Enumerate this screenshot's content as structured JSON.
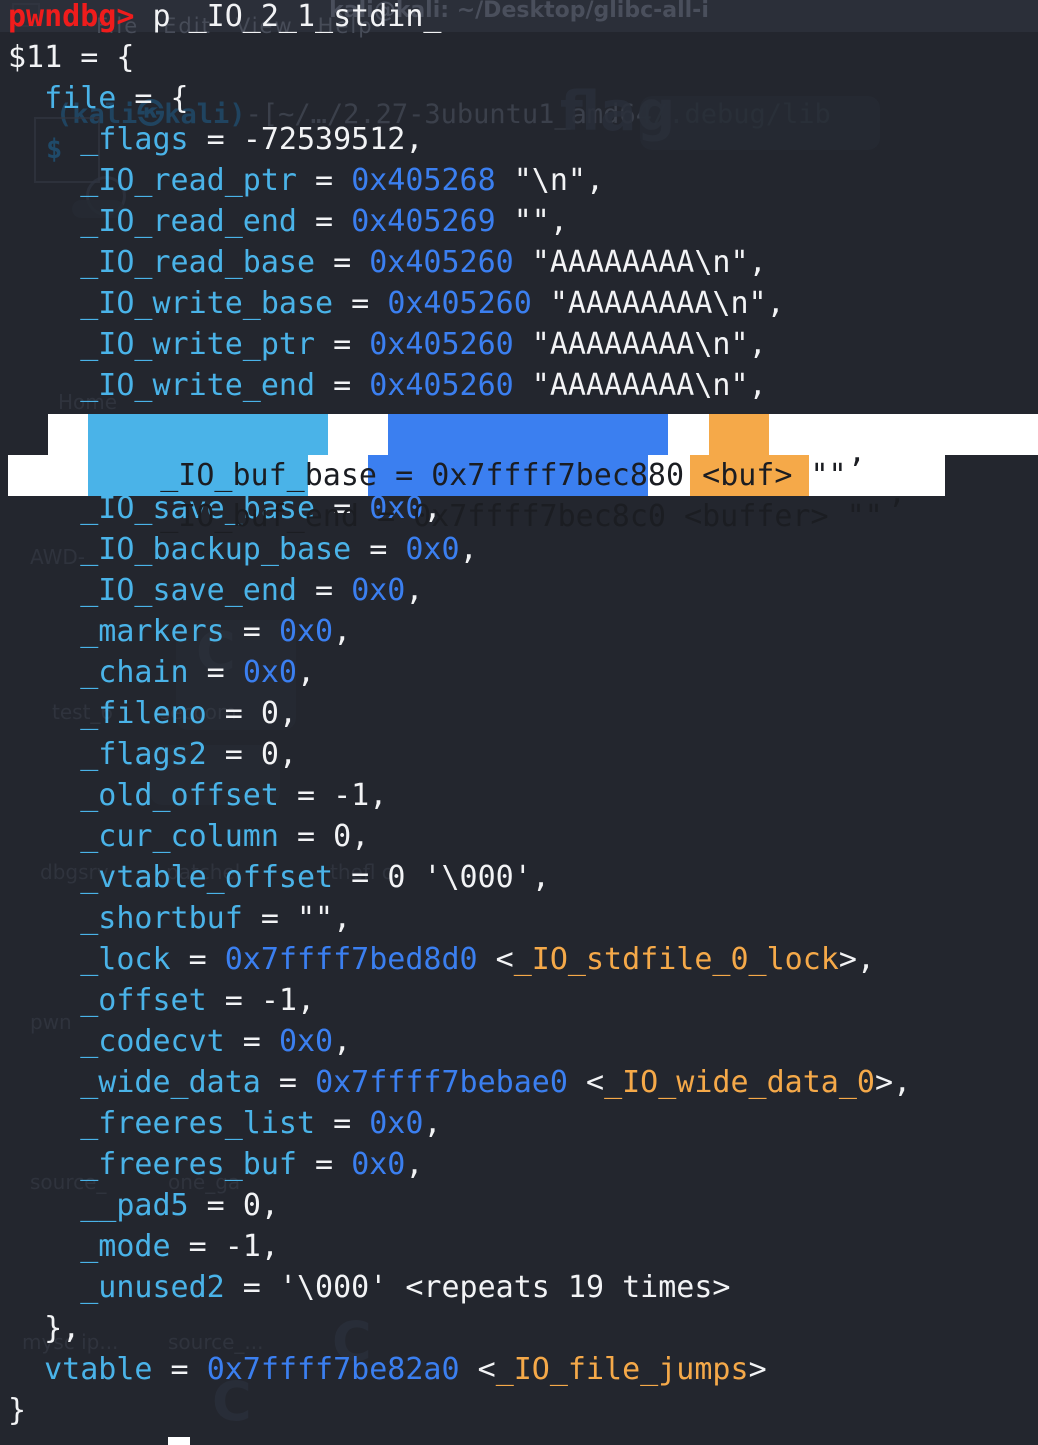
{
  "window": {
    "title": "kali@kali: ~/Desktop/glibc-all-i",
    "menu": [
      "File",
      "Edit",
      "View",
      "Help"
    ],
    "background_prompt": {
      "user_host": "(kali㉿kali)",
      "path": "-[~/…/2.27-3ubuntu1_amd64/.debug/lib",
      "dollar": "$"
    },
    "watermarks": [
      "Home",
      "AWD-",
      "test_6",
      "seccom",
      "dbgsrv",
      "patchel",
      "thefl o",
      "source_",
      "one_ga",
      "mysc ip...",
      "source_...",
      "pwn",
      "C",
      "flag"
    ]
  },
  "terminal": {
    "prompt": "pwndbg>",
    "command": "p _IO_2_1_stdin_",
    "result_var": "$11 = {",
    "struct_open": "  file = {",
    "struct_close": "  },",
    "outer_close": "}",
    "fields": [
      {
        "indent": 4,
        "name": "_flags",
        "value": "-72539512",
        "value_kind": "plain",
        "suffix": ","
      },
      {
        "indent": 4,
        "name": "_IO_read_ptr",
        "value": "0x405268",
        "value_kind": "addr",
        "extra": "\"\\n\"",
        "suffix": ","
      },
      {
        "indent": 4,
        "name": "_IO_read_end",
        "value": "0x405269",
        "value_kind": "addr",
        "extra": "\"\"",
        "suffix": ","
      },
      {
        "indent": 4,
        "name": "_IO_read_base",
        "value": "0x405260",
        "value_kind": "addr",
        "extra": "\"AAAAAAAA\\n\"",
        "suffix": ","
      },
      {
        "indent": 4,
        "name": "_IO_write_base",
        "value": "0x405260",
        "value_kind": "addr",
        "extra": "\"AAAAAAAA\\n\"",
        "suffix": ","
      },
      {
        "indent": 4,
        "name": "_IO_write_ptr",
        "value": "0x405260",
        "value_kind": "addr",
        "extra": "\"AAAAAAAA\\n\"",
        "suffix": ","
      },
      {
        "indent": 4,
        "name": "_IO_write_end",
        "value": "0x405260",
        "value_kind": "addr",
        "extra": "\"AAAAAAAA\\n\"",
        "suffix": ","
      },
      {
        "indent": 4,
        "name": "_IO_save_base",
        "value": "0x0",
        "value_kind": "addr",
        "suffix": ","
      },
      {
        "indent": 4,
        "name": "_IO_backup_base",
        "value": "0x0",
        "value_kind": "addr",
        "suffix": ","
      },
      {
        "indent": 4,
        "name": "_IO_save_end",
        "value": "0x0",
        "value_kind": "addr",
        "suffix": ","
      },
      {
        "indent": 4,
        "name": "_markers",
        "value": "0x0",
        "value_kind": "addr",
        "suffix": ","
      },
      {
        "indent": 4,
        "name": "_chain",
        "value": "0x0",
        "value_kind": "addr",
        "suffix": ","
      },
      {
        "indent": 4,
        "name": "_fileno",
        "value": "0",
        "value_kind": "plain",
        "suffix": ","
      },
      {
        "indent": 4,
        "name": "_flags2",
        "value": "0",
        "value_kind": "plain",
        "suffix": ","
      },
      {
        "indent": 4,
        "name": "_old_offset",
        "value": "-1",
        "value_kind": "plain",
        "suffix": ","
      },
      {
        "indent": 4,
        "name": "_cur_column",
        "value": "0",
        "value_kind": "plain",
        "suffix": ","
      },
      {
        "indent": 4,
        "name": "_vtable_offset",
        "value": "0",
        "value_kind": "plain",
        "extra": "'\\000'",
        "suffix": ","
      },
      {
        "indent": 4,
        "name": "_shortbuf",
        "value": "\"\"",
        "value_kind": "plain",
        "suffix": ","
      },
      {
        "indent": 4,
        "name": "_lock",
        "value": "0x7ffff7bed8d0",
        "value_kind": "addr",
        "symbol": "<_IO_stdfile_0_lock>",
        "suffix": ","
      },
      {
        "indent": 4,
        "name": "_offset",
        "value": "-1",
        "value_kind": "plain",
        "suffix": ","
      },
      {
        "indent": 4,
        "name": "_codecvt",
        "value": "0x0",
        "value_kind": "addr",
        "suffix": ","
      },
      {
        "indent": 4,
        "name": "_wide_data",
        "value": "0x7ffff7bebae0",
        "value_kind": "addr",
        "symbol": "<_IO_wide_data_0>",
        "suffix": ","
      },
      {
        "indent": 4,
        "name": "_freeres_list",
        "value": "0x0",
        "value_kind": "addr",
        "suffix": ","
      },
      {
        "indent": 4,
        "name": "_freeres_buf",
        "value": "0x0",
        "value_kind": "addr",
        "suffix": ","
      },
      {
        "indent": 4,
        "name": "__pad5",
        "value": "0",
        "value_kind": "plain",
        "suffix": ","
      },
      {
        "indent": 4,
        "name": "_mode",
        "value": "-1",
        "value_kind": "plain",
        "suffix": ","
      },
      {
        "indent": 4,
        "name": "_unused2",
        "value": "'\\000'",
        "value_kind": "plain",
        "extra": "<repeats 19 times>",
        "suffix": ""
      }
    ],
    "vtable_line": {
      "indent": 2,
      "name": "vtable",
      "value": "0x7ffff7be82a0",
      "symbol": "<_IO_file_jumps>",
      "suffix": ""
    },
    "selected_lines": [
      {
        "field": "_IO_buf_base",
        "eq": "=",
        "value": "0x7ffff7bec880",
        "symbol_open": "<",
        "symbol": "buf",
        "symbol_close": ">",
        "trailing": "\"\",",
        "string_only": "\"\"",
        "comma": ","
      },
      {
        "field": "_IO_buf_end",
        "eq": "=",
        "value": "0x7ffff7bec8c0",
        "symbol_open": "<",
        "symbol": "buffer",
        "symbol_close": ">",
        "trailing": "\"\",",
        "string_only": "\"\"",
        "comma": ","
      }
    ]
  },
  "colors": {
    "terminal_bg": "#23262e",
    "field_cyan": "#4ab3e8",
    "address_blue": "#3b7ff0",
    "symbol_orange": "#f5a949",
    "text_white": "#f2f3f5",
    "prompt_red": "#ef1c1c",
    "selection_white": "#ffffff",
    "selection_light_blue": "#4ab3e8",
    "selection_blue": "#3b7ff0",
    "selection_orange": "#f5a949"
  }
}
